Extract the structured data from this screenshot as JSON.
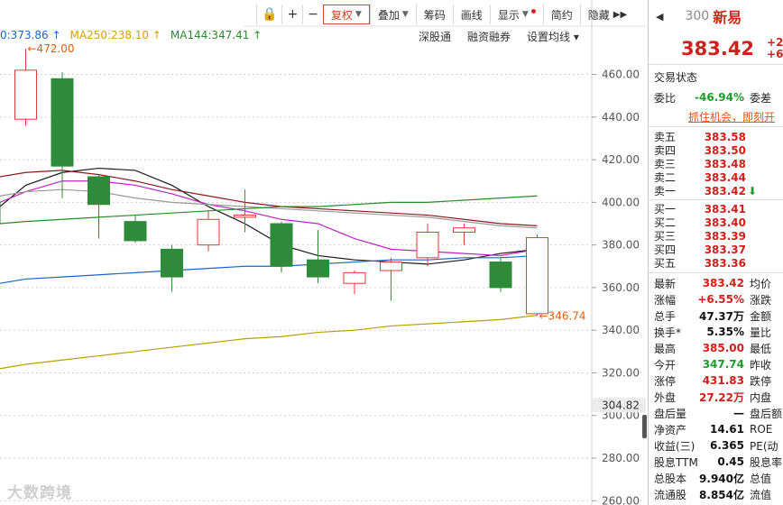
{
  "toolbar": {
    "items": [
      "复权",
      "叠加",
      "筹码",
      "画线",
      "显示",
      "简约",
      "隐藏"
    ],
    "active": "复权"
  },
  "ma_labels": [
    {
      "text": "0:373.86 ↑",
      "color": "#1a66c8"
    },
    {
      "text": "MA250:238.10 ↑",
      "color": "#d8a000"
    },
    {
      "text": "MA144:347.41 ↑",
      "color": "#2a8a2a"
    }
  ],
  "tool_row2": [
    "深股通",
    "融资融券",
    "设置均线 ▾"
  ],
  "chart_data": {
    "type": "candlestick",
    "y_axis": {
      "ticks": [
        460,
        440,
        420,
        400,
        380,
        360,
        340,
        320,
        300,
        280,
        260
      ],
      "current": "304.82",
      "range": [
        258,
        478
      ]
    },
    "annotations": [
      {
        "text": "←472.00",
        "price": 472.0
      },
      {
        "text": "←346.74",
        "price": 346.74
      }
    ],
    "candles": [
      {
        "o": 400,
        "c": 390,
        "h": 410,
        "l": 388
      },
      {
        "o": 439,
        "c": 462,
        "h": 472,
        "l": 436
      },
      {
        "o": 458,
        "c": 417,
        "h": 461,
        "l": 402
      },
      {
        "o": 412,
        "c": 399,
        "h": 413,
        "l": 383
      },
      {
        "o": 391,
        "c": 382,
        "h": 394,
        "l": 381
      },
      {
        "o": 378,
        "c": 365,
        "h": 380,
        "l": 358
      },
      {
        "o": 380,
        "c": 392,
        "h": 396,
        "l": 377
      },
      {
        "o": 393,
        "c": 394,
        "h": 406,
        "l": 386
      },
      {
        "o": 390,
        "c": 370,
        "h": 391,
        "l": 367
      },
      {
        "o": 373,
        "c": 365,
        "h": 387,
        "l": 362
      },
      {
        "o": 362,
        "c": 367,
        "h": 368,
        "l": 357
      },
      {
        "o": 368,
        "c": 372,
        "h": 374,
        "l": 354
      },
      {
        "o": 374,
        "c": 386,
        "h": 390,
        "l": 370
      },
      {
        "o": 386,
        "c": 388,
        "h": 390,
        "l": 380
      },
      {
        "o": 372,
        "c": 360,
        "h": 374,
        "l": 358
      },
      {
        "o": 347.74,
        "c": 383.42,
        "h": 385,
        "l": 346.74
      }
    ],
    "ma_lines": [
      {
        "color": "#1a1a1a",
        "values": [
          398,
          408,
          414,
          416,
          415,
          408,
          398,
          390,
          380,
          375,
          373,
          372,
          371,
          373,
          376,
          378
        ]
      },
      {
        "color": "#c020c0",
        "values": [
          400,
          405,
          410,
          410,
          408,
          404,
          399,
          396,
          392,
          390,
          383,
          378,
          377,
          376,
          375,
          378
        ]
      },
      {
        "color": "#8b1a1a",
        "values": [
          412,
          414,
          415,
          413,
          410,
          406,
          403,
          400,
          398,
          397,
          396,
          395,
          394,
          392,
          390,
          389
        ]
      },
      {
        "color": "#999999",
        "values": [
          403,
          405,
          406,
          405,
          402,
          400,
          399,
          398,
          397,
          396,
          395,
          394,
          393,
          391,
          389,
          388
        ]
      },
      {
        "color": "#2a8a2a",
        "values": [
          390,
          391,
          392,
          393,
          394,
          395,
          396,
          397,
          398,
          398,
          399,
          400,
          400,
          401,
          402,
          403
        ]
      },
      {
        "color": "#1a66c8",
        "values": [
          362,
          364,
          365,
          366,
          367,
          368,
          369,
          370,
          370,
          371,
          372,
          373,
          373,
          374,
          374,
          375
        ]
      },
      {
        "color": "#b8a000",
        "values": [
          322,
          324,
          326,
          328,
          330,
          332,
          334,
          336,
          337,
          339,
          340,
          342,
          343,
          344,
          345,
          347
        ]
      }
    ]
  },
  "watermark": "大数跨境",
  "panel": {
    "code": "300",
    "name": "新易",
    "price": "383.42",
    "chg1": "+2",
    "chg2": "+6",
    "status_label": "交易状态",
    "wb_label": "委比",
    "wb_value": "-46.94%",
    "wc_label": "委差",
    "promo": "抓住机会，即刻开",
    "asks": [
      {
        "label": "卖五",
        "price": "383.58"
      },
      {
        "label": "卖四",
        "price": "383.50"
      },
      {
        "label": "卖三",
        "price": "383.48"
      },
      {
        "label": "卖二",
        "price": "383.44"
      },
      {
        "label": "卖一",
        "price": "383.42"
      }
    ],
    "bids": [
      {
        "label": "买一",
        "price": "383.41"
      },
      {
        "label": "买二",
        "price": "383.40"
      },
      {
        "label": "买三",
        "price": "383.39"
      },
      {
        "label": "买四",
        "price": "383.37"
      },
      {
        "label": "买五",
        "price": "383.36"
      }
    ],
    "stats": [
      {
        "k": "最新",
        "v": "383.42",
        "c": "red",
        "k2": "均价"
      },
      {
        "k": "涨幅",
        "v": "+6.55%",
        "c": "red",
        "k2": "涨跌"
      },
      {
        "k": "总手",
        "v": "47.37万",
        "c": "black",
        "k2": "金额"
      },
      {
        "k": "换手*",
        "v": "5.35%",
        "c": "black",
        "k2": "量比"
      },
      {
        "k": "最高",
        "v": "385.00",
        "c": "red",
        "k2": "最低"
      },
      {
        "k": "今开",
        "v": "347.74",
        "c": "green",
        "k2": "昨收"
      },
      {
        "k": "涨停",
        "v": "431.83",
        "c": "red",
        "k2": "跌停"
      },
      {
        "k": "外盘",
        "v": "27.22万",
        "c": "red",
        "k2": "内盘"
      },
      {
        "k": "盘后量",
        "v": "—",
        "c": "black",
        "k2": "盘后额"
      },
      {
        "k": "净资产",
        "v": "14.61",
        "c": "black",
        "k2": "ROE"
      },
      {
        "k": "收益(三)",
        "v": "6.365",
        "c": "black",
        "k2": "PE(动"
      },
      {
        "k": "股息TTM",
        "v": "0.45",
        "c": "black",
        "k2": "股息率"
      },
      {
        "k": "总股本",
        "v": "9.940亿",
        "c": "black",
        "k2": "总值"
      },
      {
        "k": "流通股",
        "v": "8.854亿",
        "c": "black",
        "k2": "流值"
      }
    ]
  }
}
